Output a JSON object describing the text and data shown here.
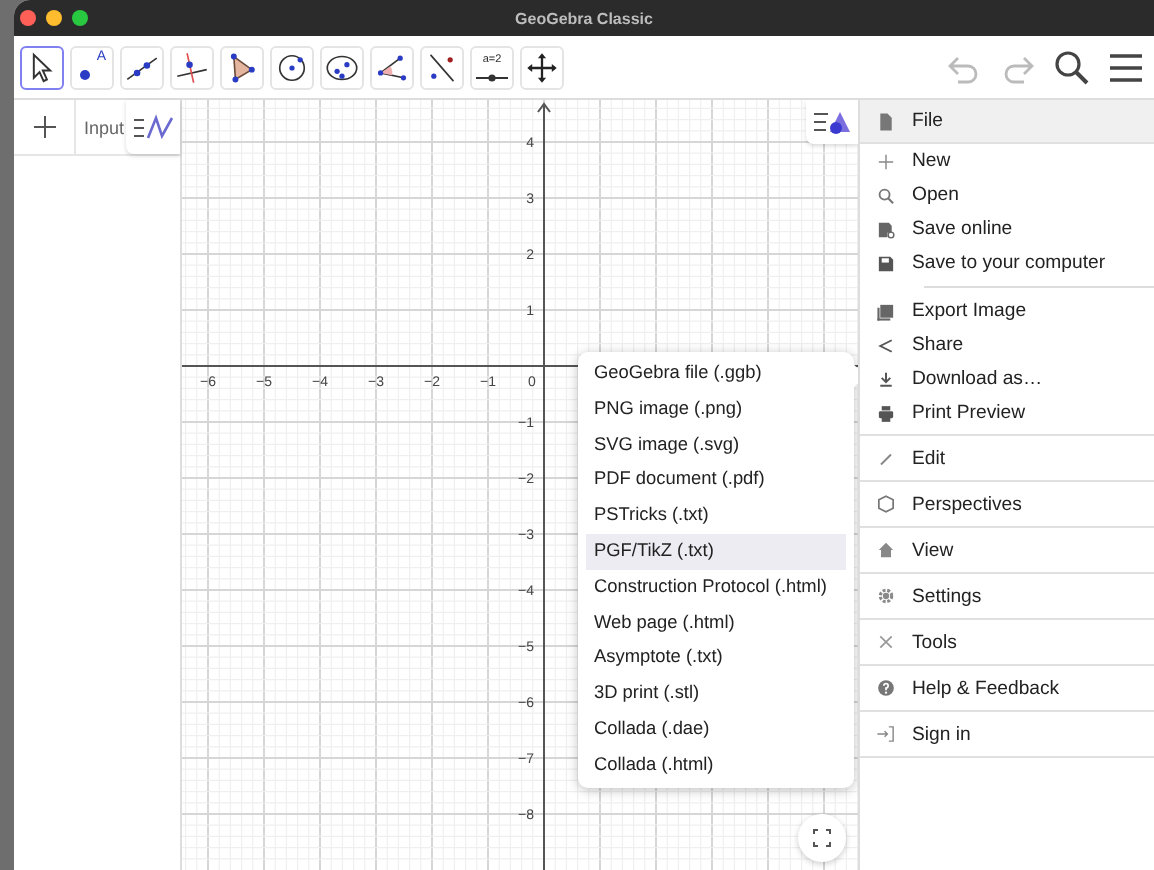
{
  "window": {
    "title": "GeoGebra Classic"
  },
  "toolbar": {
    "tools": [
      {
        "selected": true
      },
      {
        "selected": false,
        "text": "A"
      },
      {
        "selected": false
      },
      {
        "selected": false
      },
      {
        "selected": false
      },
      {
        "selected": false
      },
      {
        "selected": false
      },
      {
        "selected": false
      },
      {
        "selected": false
      },
      {
        "selected": false,
        "text": "a=2"
      },
      {
        "selected": false
      }
    ]
  },
  "algebra": {
    "input": {
      "placeholder": "Input"
    }
  },
  "graphics": {
    "x_labels": [
      "−6",
      "−5",
      "−4",
      "−3",
      "−2",
      "−1",
      "0"
    ],
    "y_labels_above": [
      "4",
      "3",
      "2",
      "1"
    ],
    "y_labels_below": [
      "−1",
      "−2",
      "−3",
      "−4",
      "−5",
      "−6",
      "−7",
      "−8"
    ]
  },
  "download_menu": {
    "items": [
      {
        "label": "GeoGebra file (.ggb)",
        "selected": false
      },
      {
        "label": "PNG image (.png)",
        "selected": false
      },
      {
        "label": "SVG image (.svg)",
        "selected": false
      },
      {
        "label": "PDF document (.pdf)",
        "selected": false
      },
      {
        "label": "PSTricks (.txt)",
        "selected": false
      },
      {
        "label": "PGF/TikZ (.txt)",
        "selected": true
      },
      {
        "label": "Construction Protocol (.html)",
        "selected": false
      },
      {
        "label": "Web page (.html)",
        "selected": false
      },
      {
        "label": "Asymptote (.txt)",
        "selected": false
      },
      {
        "label": "3D print (.stl)",
        "selected": false
      },
      {
        "label": "Collada (.dae)",
        "selected": false
      },
      {
        "label": "Collada (.html)",
        "selected": false
      }
    ]
  },
  "menu": {
    "sections": [
      {
        "label": "File",
        "expanded": true,
        "items": [
          {
            "label": "New",
            "divider_before": false
          },
          {
            "label": "Open",
            "divider_before": false
          },
          {
            "label": "Save online",
            "divider_before": false
          },
          {
            "label": "Save to your computer",
            "divider_before": false
          },
          {
            "label": "Export Image",
            "divider_before": true
          },
          {
            "label": "Share",
            "divider_before": false
          },
          {
            "label": "Download as…",
            "divider_before": false
          },
          {
            "label": "Print Preview",
            "divider_before": false
          }
        ]
      },
      {
        "label": "Edit",
        "expanded": false
      },
      {
        "label": "Perspectives",
        "expanded": false
      },
      {
        "label": "View",
        "expanded": false
      },
      {
        "label": "Settings",
        "expanded": false
      },
      {
        "label": "Tools",
        "expanded": false
      },
      {
        "label": "Help & Feedback",
        "expanded": false
      },
      {
        "label": "Sign in",
        "expanded": false
      }
    ]
  }
}
